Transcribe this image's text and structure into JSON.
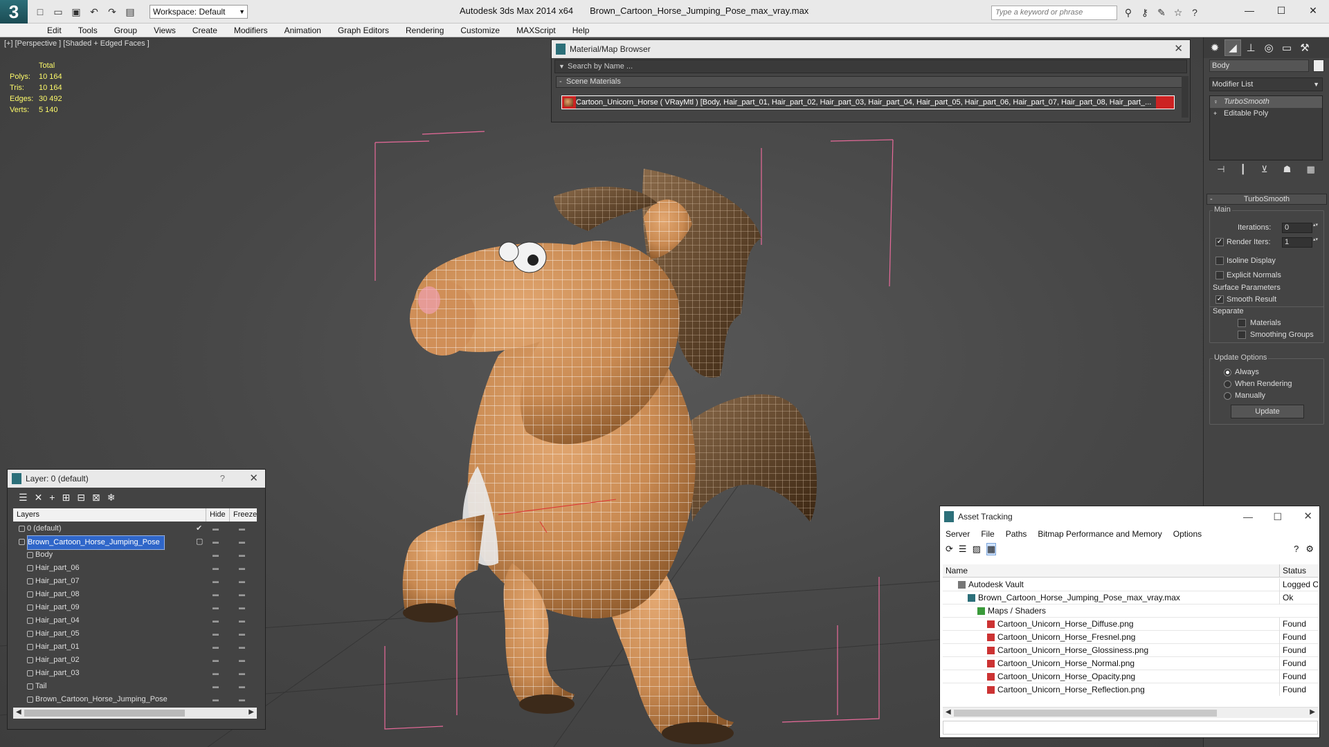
{
  "app": {
    "title": "Autodesk 3ds Max  2014 x64",
    "filename": "Brown_Cartoon_Horse_Jumping_Pose_max_vray.max",
    "workspace": "Workspace: Default",
    "search_placeholder": "Type a keyword or phrase"
  },
  "menu": [
    "Edit",
    "Tools",
    "Group",
    "Views",
    "Create",
    "Modifiers",
    "Animation",
    "Graph Editors",
    "Rendering",
    "Customize",
    "MAXScript",
    "Help"
  ],
  "viewport": {
    "label": "[+] [Perspective ] [Shaded + Edged Faces ]",
    "stats": {
      "header": "Total",
      "rows": [
        {
          "k": "Polys:",
          "v": "10 164"
        },
        {
          "k": "Tris:",
          "v": "10 164"
        },
        {
          "k": "Edges:",
          "v": "30 492"
        },
        {
          "k": "Verts:",
          "v": "5 140"
        }
      ]
    }
  },
  "material_browser": {
    "title": "Material/Map Browser",
    "search": "Search by Name ...",
    "section": "Scene Materials",
    "material": "Cartoon_Unicorn_Horse  ( VRayMtl )  [Body, Hair_part_01, Hair_part_02, Hair_part_03, Hair_part_04, Hair_part_05, Hair_part_06, Hair_part_07, Hair_part_08, Hair_part_..."
  },
  "command_panel": {
    "object_name": "Body",
    "modifier_list": "Modifier List",
    "stack": [
      "TurboSmooth",
      "Editable Poly"
    ],
    "rollout": "TurboSmooth",
    "main": "Main",
    "iterations_label": "Iterations:",
    "iterations": "0",
    "render_iters_label": "Render Iters:",
    "render_iters": "1",
    "isoline": "Isoline Display",
    "explicit": "Explicit Normals",
    "surface": "Surface Parameters",
    "smooth_result": "Smooth Result",
    "separate": "Separate",
    "materials": "Materials",
    "smoothing_groups": "Smoothing Groups",
    "update_options": "Update Options",
    "always": "Always",
    "when_rendering": "When Rendering",
    "manually": "Manually",
    "update": "Update"
  },
  "layer_panel": {
    "title": "Layer: 0 (default)",
    "help": "?",
    "columns": {
      "layers": "Layers",
      "hide": "Hide",
      "freeze": "Freeze"
    },
    "rows": [
      {
        "name": "0 (default)",
        "level": 0
      },
      {
        "name": "Brown_Cartoon_Horse_Jumping_Pose",
        "level": 0
      },
      {
        "name": "Body",
        "level": 1
      },
      {
        "name": "Hair_part_06",
        "level": 1
      },
      {
        "name": "Hair_part_07",
        "level": 1
      },
      {
        "name": "Hair_part_08",
        "level": 1
      },
      {
        "name": "Hair_part_09",
        "level": 1
      },
      {
        "name": "Hair_part_04",
        "level": 1
      },
      {
        "name": "Hair_part_05",
        "level": 1
      },
      {
        "name": "Hair_part_01",
        "level": 1
      },
      {
        "name": "Hair_part_02",
        "level": 1
      },
      {
        "name": "Hair_part_03",
        "level": 1
      },
      {
        "name": "Tail",
        "level": 1
      },
      {
        "name": "Brown_Cartoon_Horse_Jumping_Pose",
        "level": 1
      }
    ]
  },
  "asset_tracking": {
    "title": "Asset Tracking",
    "menu": [
      "Server",
      "File",
      "Paths",
      "Bitmap Performance and Memory",
      "Options"
    ],
    "columns": {
      "name": "Name",
      "status": "Status"
    },
    "rows": [
      {
        "name": "Autodesk Vault",
        "status": "Logged Out",
        "level": 1
      },
      {
        "name": "Brown_Cartoon_Horse_Jumping_Pose_max_vray.max",
        "status": "Ok",
        "level": 2
      },
      {
        "name": "Maps / Shaders",
        "status": "",
        "level": 3
      },
      {
        "name": "Cartoon_Unicorn_Horse_Diffuse.png",
        "status": "Found",
        "level": 4
      },
      {
        "name": "Cartoon_Unicorn_Horse_Fresnel.png",
        "status": "Found",
        "level": 4
      },
      {
        "name": "Cartoon_Unicorn_Horse_Glossiness.png",
        "status": "Found",
        "level": 4
      },
      {
        "name": "Cartoon_Unicorn_Horse_Normal.png",
        "status": "Found",
        "level": 4
      },
      {
        "name": "Cartoon_Unicorn_Horse_Opacity.png",
        "status": "Found",
        "level": 4
      },
      {
        "name": "Cartoon_Unicorn_Horse_Reflection.png",
        "status": "Found",
        "level": 4
      }
    ]
  },
  "colors": {
    "accent": "#2c6f79",
    "selection": "#2f66c9",
    "stats": "#fdfa6a",
    "body": "#c98a52",
    "wire": "#ffffff"
  }
}
